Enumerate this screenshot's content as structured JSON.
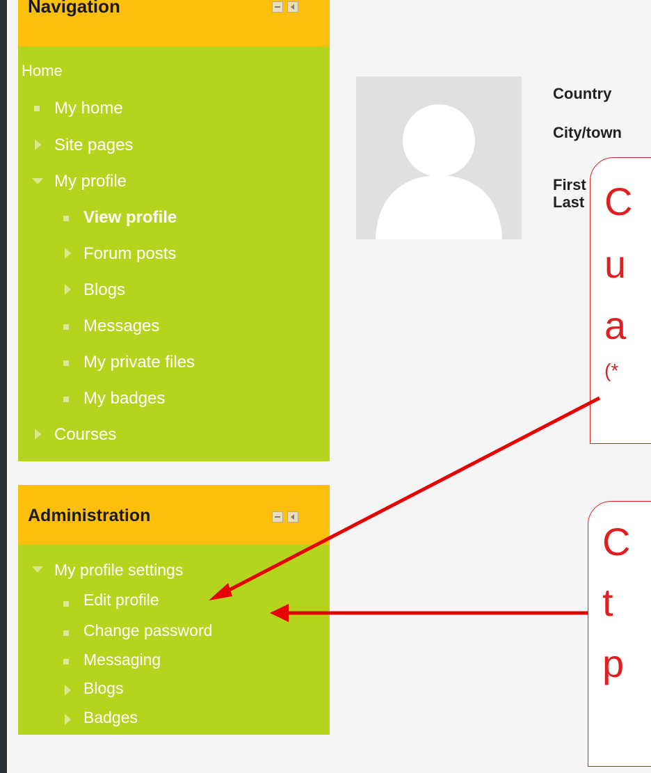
{
  "navigation_block": {
    "title": "Navigation",
    "items": [
      {
        "label": "Home",
        "icon": "none",
        "bold": false
      },
      {
        "label": "My home",
        "icon": "square-bullet-icon",
        "bold": false
      },
      {
        "label": "Site pages",
        "icon": "expand-arrow-icon",
        "bold": false
      },
      {
        "label": "My profile",
        "icon": "collapse-arrow-icon",
        "bold": false
      },
      {
        "label": "View profile",
        "icon": "square-bullet-icon",
        "bold": true
      },
      {
        "label": "Forum posts",
        "icon": "expand-arrow-icon",
        "bold": false
      },
      {
        "label": "Blogs",
        "icon": "expand-arrow-icon",
        "bold": false
      },
      {
        "label": "Messages",
        "icon": "square-bullet-icon",
        "bold": false
      },
      {
        "label": "My private files",
        "icon": "square-bullet-icon",
        "bold": false
      },
      {
        "label": "My badges",
        "icon": "square-bullet-icon",
        "bold": false
      },
      {
        "label": "Courses",
        "icon": "expand-arrow-icon",
        "bold": false
      }
    ]
  },
  "administration_block": {
    "title": "Administration",
    "items": [
      {
        "label": "My profile settings",
        "icon": "collapse-arrow-icon"
      },
      {
        "label": "Edit profile",
        "icon": "square-bullet-icon"
      },
      {
        "label": "Change password",
        "icon": "square-bullet-icon"
      },
      {
        "label": "Messaging",
        "icon": "square-bullet-icon"
      },
      {
        "label": "Blogs",
        "icon": "expand-arrow-icon"
      },
      {
        "label": "Badges",
        "icon": "expand-arrow-icon"
      }
    ]
  },
  "profile": {
    "fields": [
      "Country",
      "City/town",
      "First",
      "Last"
    ]
  },
  "callouts": {
    "first": {
      "lines": [
        "C",
        "u",
        "a"
      ],
      "note": "(*"
    },
    "second": {
      "lines": [
        "C",
        "t",
        "p"
      ]
    }
  },
  "colors": {
    "block_header": "#fcbf0c",
    "block_body": "#b5d41d",
    "annotation_red": "#e02020"
  }
}
